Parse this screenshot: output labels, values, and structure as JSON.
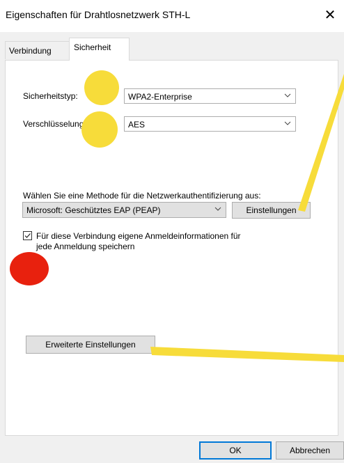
{
  "window": {
    "title": "Eigenschaften für Drahtlosnetzwerk STH-L",
    "close_glyph": "✕"
  },
  "tabs": [
    {
      "label": "Verbindung",
      "active": false
    },
    {
      "label": "Sicherheit",
      "active": true
    }
  ],
  "security": {
    "type_label": "Sicherheitstyp:",
    "type_value": "WPA2-Enterprise",
    "encryption_label": "Verschlüsselungstyp:",
    "encryption_value": "AES"
  },
  "auth": {
    "method_label": "Wählen Sie eine Methode für die Netzwerkauthentifizierung aus:",
    "method_value": "Microsoft: Geschütztes EAP (PEAP)",
    "settings_button": "Einstellungen",
    "remember_checked": true,
    "remember_line1": "Für diese Verbindung eigene Anmeldeinformationen für",
    "remember_line2": "jede Anmeldung speichern"
  },
  "advanced_button": "Erweiterte Einstellungen",
  "footer": {
    "ok_button": "OK",
    "cancel_button": "Abbrechen"
  },
  "annotations": {
    "yellow": "#f7dc3a",
    "red": "#e8210e"
  },
  "icons": {
    "close": "close-icon",
    "dropdown": "chevron-down-icon",
    "check": "checkmark-icon"
  }
}
